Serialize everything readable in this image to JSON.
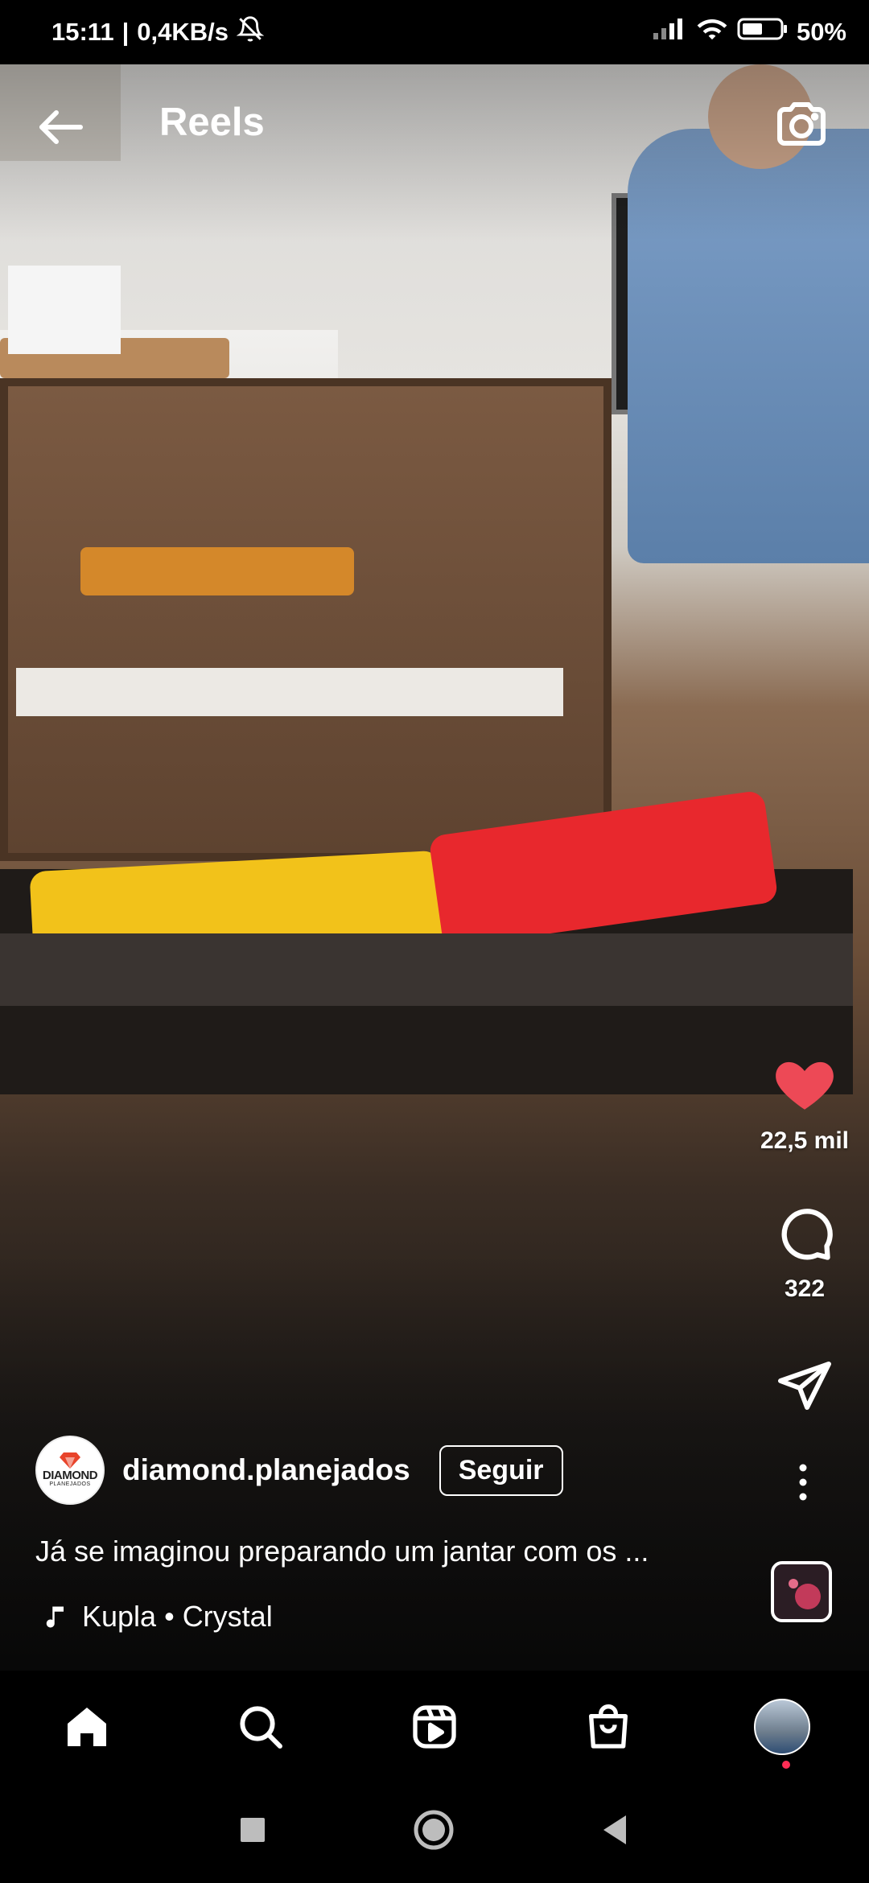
{
  "status_bar": {
    "time": "15:11",
    "separator": "|",
    "speed": "0,4KB/s",
    "battery": "50%"
  },
  "header": {
    "title": "Reels"
  },
  "actions": {
    "likes": "22,5 mil",
    "comments": "322"
  },
  "author": {
    "avatar_text": "DIAMOND",
    "avatar_subtext": "PLANEJADOS",
    "username": "diamond.planejados",
    "follow_label": "Seguir"
  },
  "caption": "Já se imaginou preparando um jantar com os ...",
  "audio": {
    "artist": "Kupla",
    "dot": "•",
    "track": "Crystal"
  },
  "colors": {
    "like": "#ed4956",
    "notification": "#ff2d55"
  },
  "icons": {
    "back": "arrow-left-icon",
    "camera": "camera-icon",
    "like": "heart-icon",
    "comment": "comment-icon",
    "share": "send-icon",
    "more": "more-vertical-icon",
    "music": "music-note-icon"
  }
}
